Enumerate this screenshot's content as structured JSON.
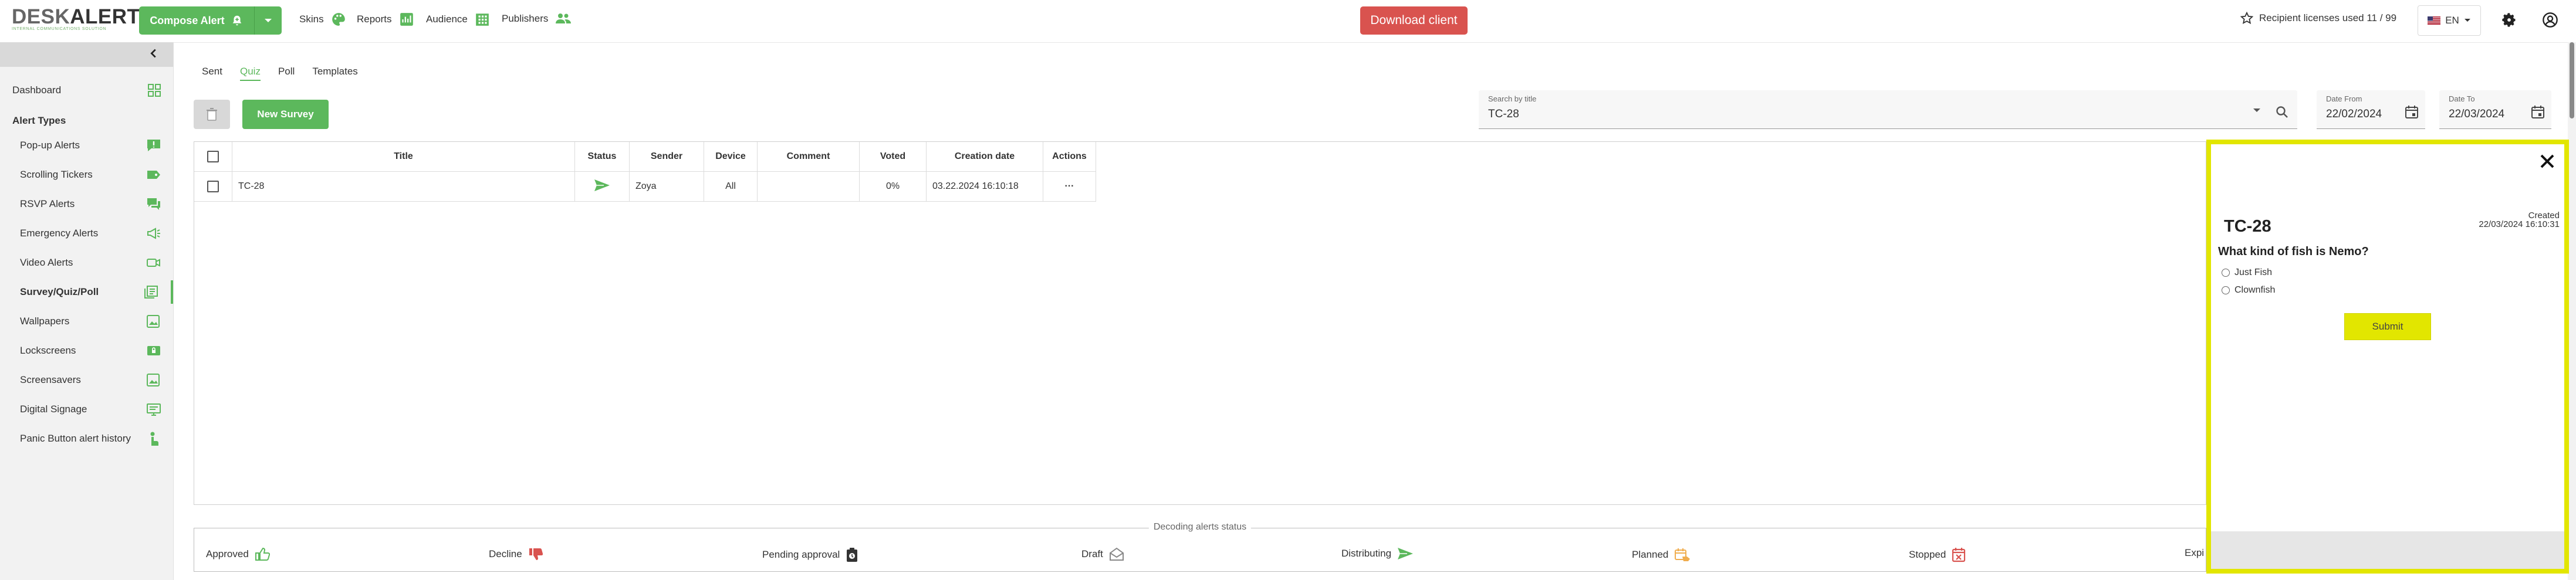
{
  "header": {
    "logo_main": "DESK",
    "logo_accent": "ALERTS",
    "logo_tagline": "INTERNAL COMMUNICATIONS SOLUTION",
    "compose_label": "Compose Alert",
    "nav": [
      {
        "label": "Skins",
        "icon": "palette-icon"
      },
      {
        "label": "Reports",
        "icon": "chart-icon"
      },
      {
        "label": "Audience",
        "icon": "building-icon"
      },
      {
        "label": "Publishers",
        "icon": "people-icon"
      }
    ],
    "download_label": "Download client",
    "licenses_label": "Recipient licenses used 11 / 99",
    "language": "EN",
    "accent_color": "#5cb85c",
    "danger_color": "#d9534f"
  },
  "sidebar": {
    "dashboard_label": "Dashboard",
    "section_title": "Alert Types",
    "items": [
      {
        "label": "Pop-up Alerts",
        "icon": "popup-alert-icon"
      },
      {
        "label": "Scrolling Tickers",
        "icon": "ticker-icon"
      },
      {
        "label": "RSVP Alerts",
        "icon": "rsvp-chat-icon"
      },
      {
        "label": "Emergency Alerts",
        "icon": "megaphone-icon"
      },
      {
        "label": "Video Alerts",
        "icon": "video-icon"
      },
      {
        "label": "Survey/Quiz/Poll",
        "icon": "survey-icon",
        "active": true
      },
      {
        "label": "Wallpapers",
        "icon": "wallpaper-icon"
      },
      {
        "label": "Lockscreens",
        "icon": "lockscreen-icon"
      },
      {
        "label": "Screensavers",
        "icon": "screensaver-icon"
      },
      {
        "label": "Digital Signage",
        "icon": "signage-icon"
      },
      {
        "label": "Panic Button alert history",
        "icon": "panic-hand-icon"
      }
    ]
  },
  "tabs": [
    "Sent",
    "Quiz",
    "Poll",
    "Templates"
  ],
  "active_tab": "Quiz",
  "toolbar": {
    "new_survey_label": "New Survey",
    "search_label": "Search by title",
    "search_value": "TC-28",
    "date_from_label": "Date From",
    "date_from_value": "22/02/2024",
    "date_to_label": "Date To",
    "date_to_value": "22/03/2024"
  },
  "table": {
    "columns": [
      "Title",
      "Status",
      "Sender",
      "Device",
      "Comment",
      "Voted",
      "Creation date",
      "Actions"
    ],
    "rows": [
      {
        "title": "TC-28",
        "status_icon": "distributing-icon",
        "sender": "Zoya",
        "device": "All",
        "comment": "",
        "voted": "0%",
        "creation_date": "03.22.2024 16:10:18",
        "actions": "···"
      }
    ]
  },
  "legend": {
    "title": "Decoding alerts status",
    "items": [
      {
        "label": "Approved",
        "icon": "thumbs-up-icon"
      },
      {
        "label": "Decline",
        "icon": "thumbs-down-icon"
      },
      {
        "label": "Pending approval",
        "icon": "clipboard-clock-icon"
      },
      {
        "label": "Draft",
        "icon": "envelope-open-icon"
      },
      {
        "label": "Distributing",
        "icon": "send-icon"
      },
      {
        "label": "Planned",
        "icon": "calendar-hand-icon"
      },
      {
        "label": "Stopped",
        "icon": "calendar-x-icon"
      },
      {
        "label": "Expi"
      }
    ]
  },
  "preview": {
    "title": "TC-28",
    "created_label": "Created",
    "created_value": "22/03/2024 16:10:31",
    "question": "What kind of fish is Nemo?",
    "options": [
      "Just Fish",
      "Clownfish"
    ],
    "submit_label": "Submit",
    "highlight_color": "#e2e600"
  }
}
